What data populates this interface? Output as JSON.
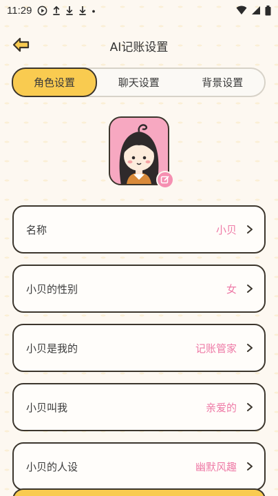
{
  "status_bar": {
    "time": "11:29"
  },
  "header": {
    "title": "AI记账设置"
  },
  "tabs": [
    {
      "label": "角色设置",
      "active": true
    },
    {
      "label": "聊天设置",
      "active": false
    },
    {
      "label": "背景设置",
      "active": false
    }
  ],
  "settings": [
    {
      "label": "名称",
      "value": "小贝"
    },
    {
      "label": "小贝的性别",
      "value": "女"
    },
    {
      "label": "小贝是我的",
      "value": "记账管家"
    },
    {
      "label": "小贝叫我",
      "value": "亲爱的"
    },
    {
      "label": "小贝的人设",
      "value": "幽默风趣"
    }
  ],
  "colors": {
    "accent": "#f9cb50",
    "pink": "#ee7aa6",
    "border": "#3b352c",
    "background": "#fdf8f1"
  },
  "icons": [
    "back-arrow-icon",
    "edit-icon",
    "chevron-right-icon",
    "wifi-icon",
    "signal-icon",
    "battery-icon"
  ]
}
